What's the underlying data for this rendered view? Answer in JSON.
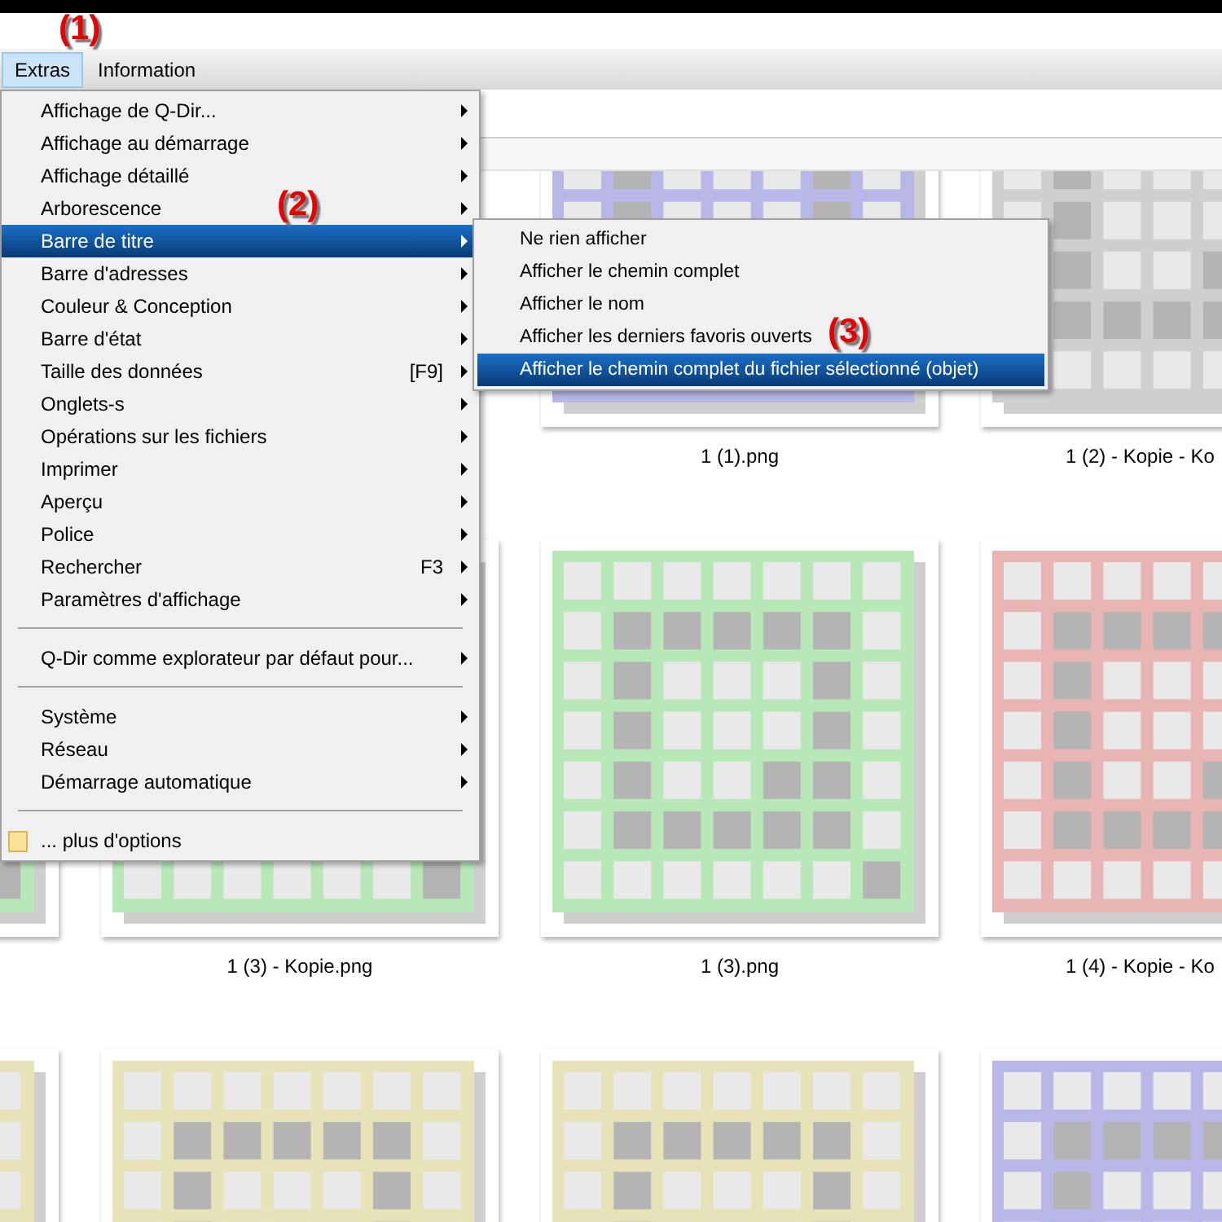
{
  "menubar": [
    {
      "label": "Extras",
      "selected": true
    },
    {
      "label": "Information",
      "selected": false
    }
  ],
  "annotations": [
    "(1)",
    "(2)",
    "(3)"
  ],
  "menu": [
    {
      "kind": "item",
      "label": "Affichage de Q-Dir...",
      "selected": false
    },
    {
      "kind": "item",
      "label": "Affichage au démarrage",
      "selected": false
    },
    {
      "kind": "item",
      "label": "Affichage détaillé",
      "selected": false
    },
    {
      "kind": "item",
      "label": "Arborescence",
      "selected": false
    },
    {
      "kind": "item",
      "label": "Barre de titre",
      "selected": true
    },
    {
      "kind": "item",
      "label": "Barre d'adresses",
      "selected": false
    },
    {
      "kind": "item",
      "label": "Couleur & Conception",
      "selected": false
    },
    {
      "kind": "item",
      "label": "Barre d'état",
      "selected": false
    },
    {
      "kind": "item",
      "label": "Taille des données",
      "shortcut": "[F9]",
      "selected": false
    },
    {
      "kind": "item",
      "label": "Onglets-s",
      "selected": false
    },
    {
      "kind": "item",
      "label": "Opérations sur les fichiers",
      "selected": false
    },
    {
      "kind": "item",
      "label": "Imprimer",
      "selected": false
    },
    {
      "kind": "item",
      "label": "Aperçu",
      "selected": false
    },
    {
      "kind": "item",
      "label": "Police",
      "selected": false
    },
    {
      "kind": "item",
      "label": "Rechercher",
      "shortcut": "F3",
      "selected": false
    },
    {
      "kind": "item",
      "label": "Paramètres d'affichage",
      "selected": false
    },
    {
      "kind": "separator"
    },
    {
      "kind": "item",
      "label": "Q-Dir comme explorateur par défaut pour...",
      "selected": false
    },
    {
      "kind": "separator"
    },
    {
      "kind": "item",
      "label": "Système",
      "selected": false
    },
    {
      "kind": "item",
      "label": "Réseau",
      "selected": false
    },
    {
      "kind": "item",
      "label": "Démarrage automatique",
      "selected": false
    },
    {
      "kind": "separator"
    },
    {
      "kind": "folder-item",
      "label": "... plus d'options",
      "selected": false
    }
  ],
  "submenu": [
    {
      "label": "Ne rien afficher",
      "selected": false
    },
    {
      "label": "Afficher le chemin complet",
      "selected": false
    },
    {
      "label": "Afficher le nom",
      "selected": false
    },
    {
      "label": "Afficher les derniers favoris ouverts",
      "selected": false
    },
    {
      "label": "Afficher le chemin complet du fichier sélectionné (objet)",
      "selected": true
    }
  ],
  "thumbnail_rows": [
    [
      {},
      {},
      {
        "color": "#b8b8e8",
        "label": "1 (1).png"
      },
      {
        "color": "#cfcfcf",
        "label": "1 (2) - Kopie - Ko"
      }
    ],
    [
      {
        "color": "#b9e8b8"
      },
      {
        "color": "#b9e8b8",
        "label": "1 (3) - Kopie.png"
      },
      {
        "color": "#b9e8b8",
        "label": "1 (3).png"
      },
      {
        "color": "#e8b4b4",
        "label": "1 (4) - Kopie - Ko"
      }
    ],
    [
      {
        "color": "#e8e2b8"
      },
      {
        "color": "#e8e2b8"
      },
      {
        "color": "#e8e2b8"
      },
      {
        "color": "#b8b8e8"
      }
    ]
  ]
}
